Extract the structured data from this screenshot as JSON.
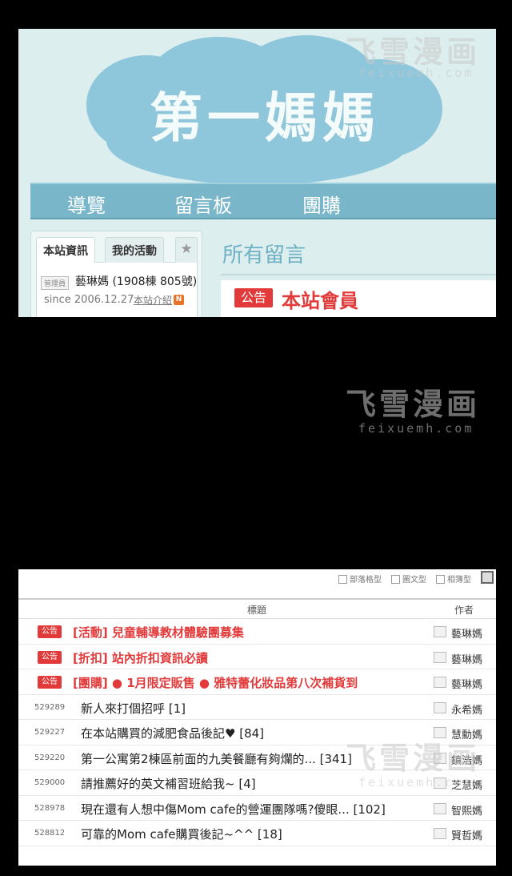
{
  "cafe": {
    "title": "第一媽媽",
    "nav": [
      "導覽",
      "留言板",
      "團購"
    ],
    "tabs": {
      "site_info": "本站資訊",
      "my_activity": "我的活動",
      "star": "★"
    },
    "admin_badge": "管理員",
    "admin_name": "藝琳媽 (1908棟 805號)",
    "since": "since 2006.12.27.",
    "intro_link": "本站介紹",
    "new_badge": "N",
    "all_messages": "所有留言",
    "notice_badge": "公告",
    "notice_text": "本站會員"
  },
  "board": {
    "view_options": [
      "部落格型",
      "圖文型",
      "相簿型"
    ],
    "header": {
      "title": "標題",
      "author": "作者"
    },
    "rows": [
      {
        "num": "",
        "badge": "公告",
        "title": "[活動] 兒童輔導教材體驗團募集",
        "author": "藝琳媽"
      },
      {
        "num": "",
        "badge": "公告",
        "title": "[折扣] 站內折扣資訊必讀",
        "author": "藝琳媽"
      },
      {
        "num": "",
        "badge": "公告",
        "title": "[團購] ● 1月限定販售 ● 雅特蕾化妝品第八次補貨到",
        "author": "藝琳媽"
      },
      {
        "num": "529289",
        "badge": "",
        "title": "新人來打個招呼 [1]",
        "author": "永希媽"
      },
      {
        "num": "529227",
        "badge": "",
        "title": "在本站購買的減肥食品後記♥ [84]",
        "author": "慧勳媽"
      },
      {
        "num": "529220",
        "badge": "",
        "title": "第一公寓第2棟區前面的九美餐廳有夠爛的... [341]",
        "author": "鎮浩媽"
      },
      {
        "num": "529000",
        "badge": "",
        "title": "請推薦好的英文補習班給我~ [4]",
        "author": "芝慧媽"
      },
      {
        "num": "528978",
        "badge": "",
        "title": "現在還有人想中傷Mom cafe的營運團隊嗎?傻眼... [102]",
        "author": "智熙媽"
      },
      {
        "num": "528812",
        "badge": "",
        "title": "可靠的Mom cafe購買後記~^^ [18]",
        "author": "賢哲媽"
      }
    ]
  },
  "watermark": {
    "title": "飞雪漫画",
    "url": "feixuemh.com"
  },
  "colors": {
    "accent": "#7ab6c9",
    "notice_red": "#e23a3a",
    "cafe_bg": "#dcefee"
  }
}
